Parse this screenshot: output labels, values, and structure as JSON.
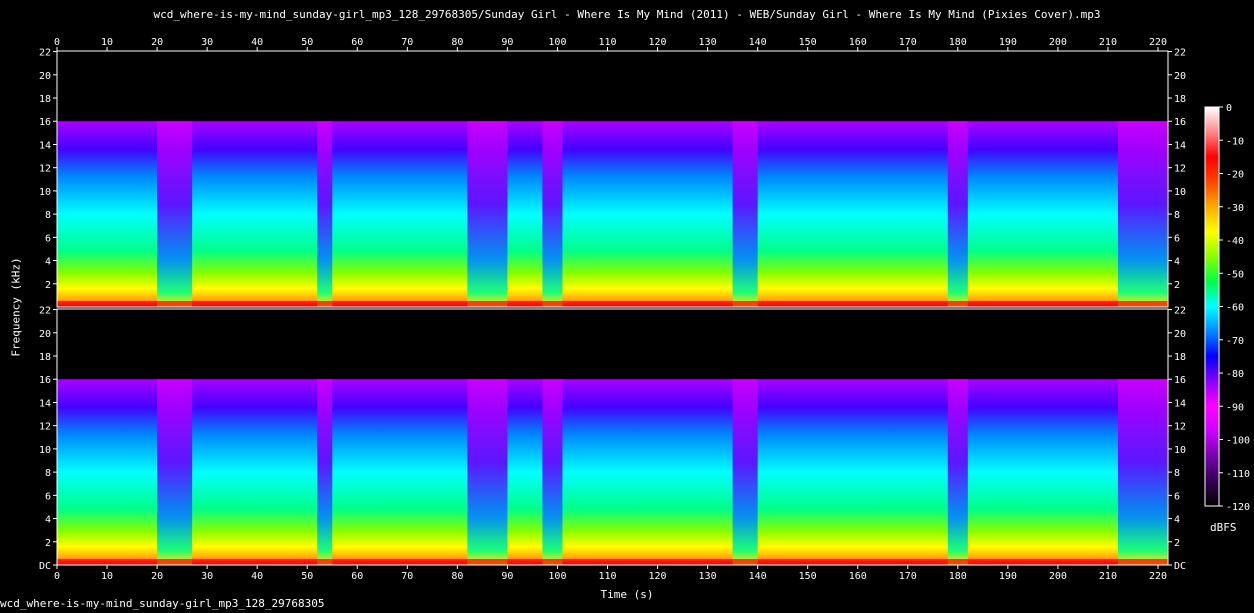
{
  "title": "wcd_where-is-my-mind_sunday-girl_mp3_128_29768305/Sunday Girl - Where Is My Mind (2011) - WEB/Sunday Girl - Where Is My Mind (Pixies Cover).mp3",
  "footer": "wcd_where-is-my-mind_sunday-girl_mp3_128_29768305",
  "chart_data": {
    "type": "heatmap",
    "title": "wcd_where-is-my-mind_sunday-girl_mp3_128_29768305/Sunday Girl - Where Is My Mind (2011) - WEB/Sunday Girl - Where Is My Mind (Pixies Cover).mp3",
    "xlabel": "Time (s)",
    "ylabel": "Frequency (kHz)",
    "colorbar_label": "dBFS",
    "x_ticks": [
      0,
      10,
      20,
      30,
      40,
      50,
      60,
      70,
      80,
      90,
      100,
      110,
      120,
      130,
      140,
      150,
      160,
      170,
      180,
      190,
      200,
      210,
      220
    ],
    "xlim": [
      0,
      222
    ],
    "y_ticks": [
      "DC",
      "2",
      "4",
      "6",
      "8",
      "10",
      "12",
      "14",
      "16",
      "18",
      "20",
      "22"
    ],
    "ylim": [
      0,
      22.05
    ],
    "colorbar_ticks": [
      0,
      -10,
      -20,
      -30,
      -40,
      -50,
      -60,
      -70,
      -80,
      -90,
      -100,
      -110,
      -120
    ],
    "colorbar_range": [
      -120,
      0
    ],
    "channels": 2,
    "lowpass_cutoff_khz": 16,
    "colormap": [
      "#000000",
      "#330055",
      "#7700aa",
      "#cc00ff",
      "#ff00ff",
      "#8800ff",
      "#0000ff",
      "#0088ff",
      "#00ffff",
      "#00ff44",
      "#88ff00",
      "#ffff00",
      "#ffaa00",
      "#ff4400",
      "#ff0000",
      "#ff8888",
      "#ffffff"
    ],
    "quiet_sections_s": [
      [
        20,
        27
      ],
      [
        52,
        55
      ],
      [
        82,
        90
      ],
      [
        97,
        101
      ],
      [
        135,
        140
      ],
      [
        178,
        182
      ],
      [
        212,
        222
      ]
    ]
  }
}
